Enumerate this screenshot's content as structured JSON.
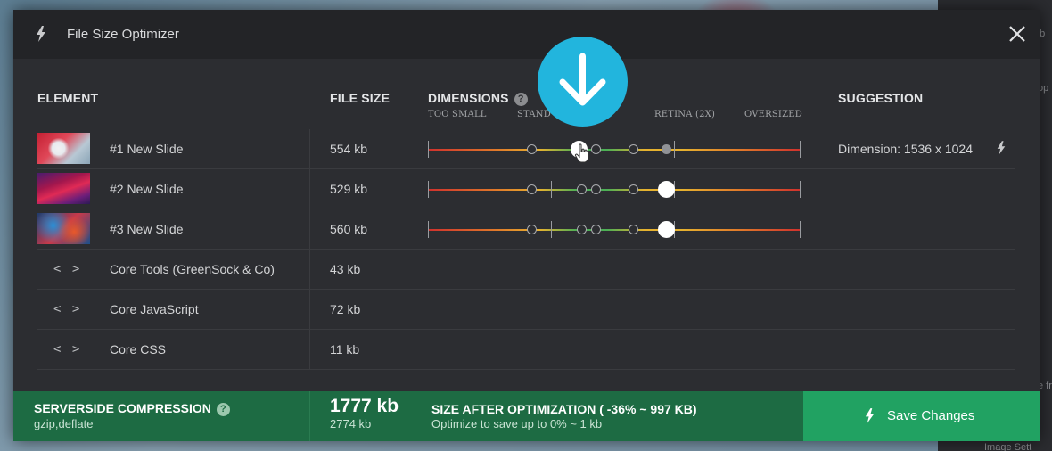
{
  "background": {
    "right_panel_text_1": "ub",
    "right_panel_text_2": "op",
    "right_panel_text_3": "e fr",
    "right_panel_text_4": "Image Sett"
  },
  "modal": {
    "title": "File Size Optimizer",
    "close_icon": "close-icon"
  },
  "columns": {
    "element": "ELEMENT",
    "file_size": "FILE SIZE",
    "dimensions": "DIMENSIONS",
    "suggestion": "SUGGESTION"
  },
  "scale_labels": [
    "TOO SMALL",
    "STAND",
    "RETINA (2X)",
    "OVERSIZED"
  ],
  "rows": [
    {
      "type": "slide",
      "name": "#1 New Slide",
      "size": "554 kb",
      "suggestion": "Dimension: 1536 x 1024",
      "has_slider": true
    },
    {
      "type": "slide",
      "name": "#2 New Slide",
      "size": "529 kb",
      "suggestion": "",
      "has_slider": true
    },
    {
      "type": "slide",
      "name": "#3 New Slide",
      "size": "560 kb",
      "suggestion": "",
      "has_slider": true
    },
    {
      "type": "code",
      "name": "Core Tools (GreenSock & Co)",
      "size": "43 kb",
      "icon": "< >"
    },
    {
      "type": "code",
      "name": "Core JavaScript",
      "size": "72 kb",
      "icon": "< >"
    },
    {
      "type": "code",
      "name": "Core CSS",
      "size": "11 kb",
      "icon": "< >"
    }
  ],
  "footer": {
    "compression_title": "SERVERSIDE COMPRESSION",
    "compression_value": "gzip,deflate",
    "total_size": "1777 kb",
    "original_size": "2774 kb",
    "after_title": "SIZE AFTER OPTIMIZATION ( -36% ~ 997 KB)",
    "after_sub": "Optimize to save up to 0% ~ 1 kb",
    "save_label": "Save Changes"
  },
  "colors": {
    "accent_blue": "#22b5dd",
    "footer_green": "#1d6b43",
    "save_green": "#21a262"
  }
}
